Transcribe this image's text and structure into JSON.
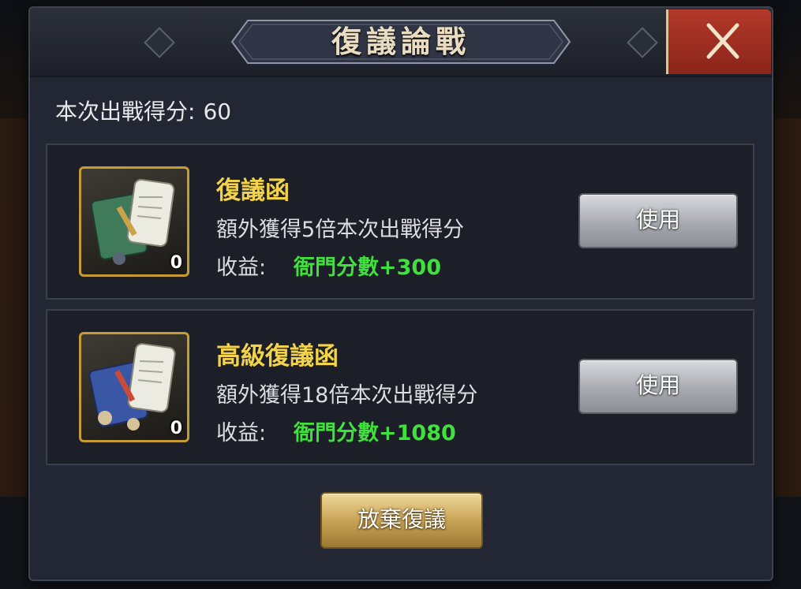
{
  "dialog": {
    "title": "復議論戰",
    "close_icon": "close-x-icon"
  },
  "score": {
    "label": "本次出戰得分:",
    "value": "60"
  },
  "items": [
    {
      "icon": "green-scroll-icon",
      "name": "復議函",
      "count": "0",
      "description": "額外獲得5倍本次出戰得分",
      "reward_label": "收益:",
      "reward_value": "衙門分數+300",
      "use_label": "使用"
    },
    {
      "icon": "blue-scroll-icon",
      "name": "高級復議函",
      "count": "0",
      "description": "額外獲得18倍本次出戰得分",
      "reward_label": "收益:",
      "reward_value": "衙門分數+1080",
      "use_label": "使用"
    }
  ],
  "footer": {
    "abandon_label": "放棄復議"
  },
  "colors": {
    "item_name": "#f3d34b",
    "reward_value": "#40e03d",
    "close_button": "#b3392a",
    "icon_frame": "#c79b32"
  }
}
